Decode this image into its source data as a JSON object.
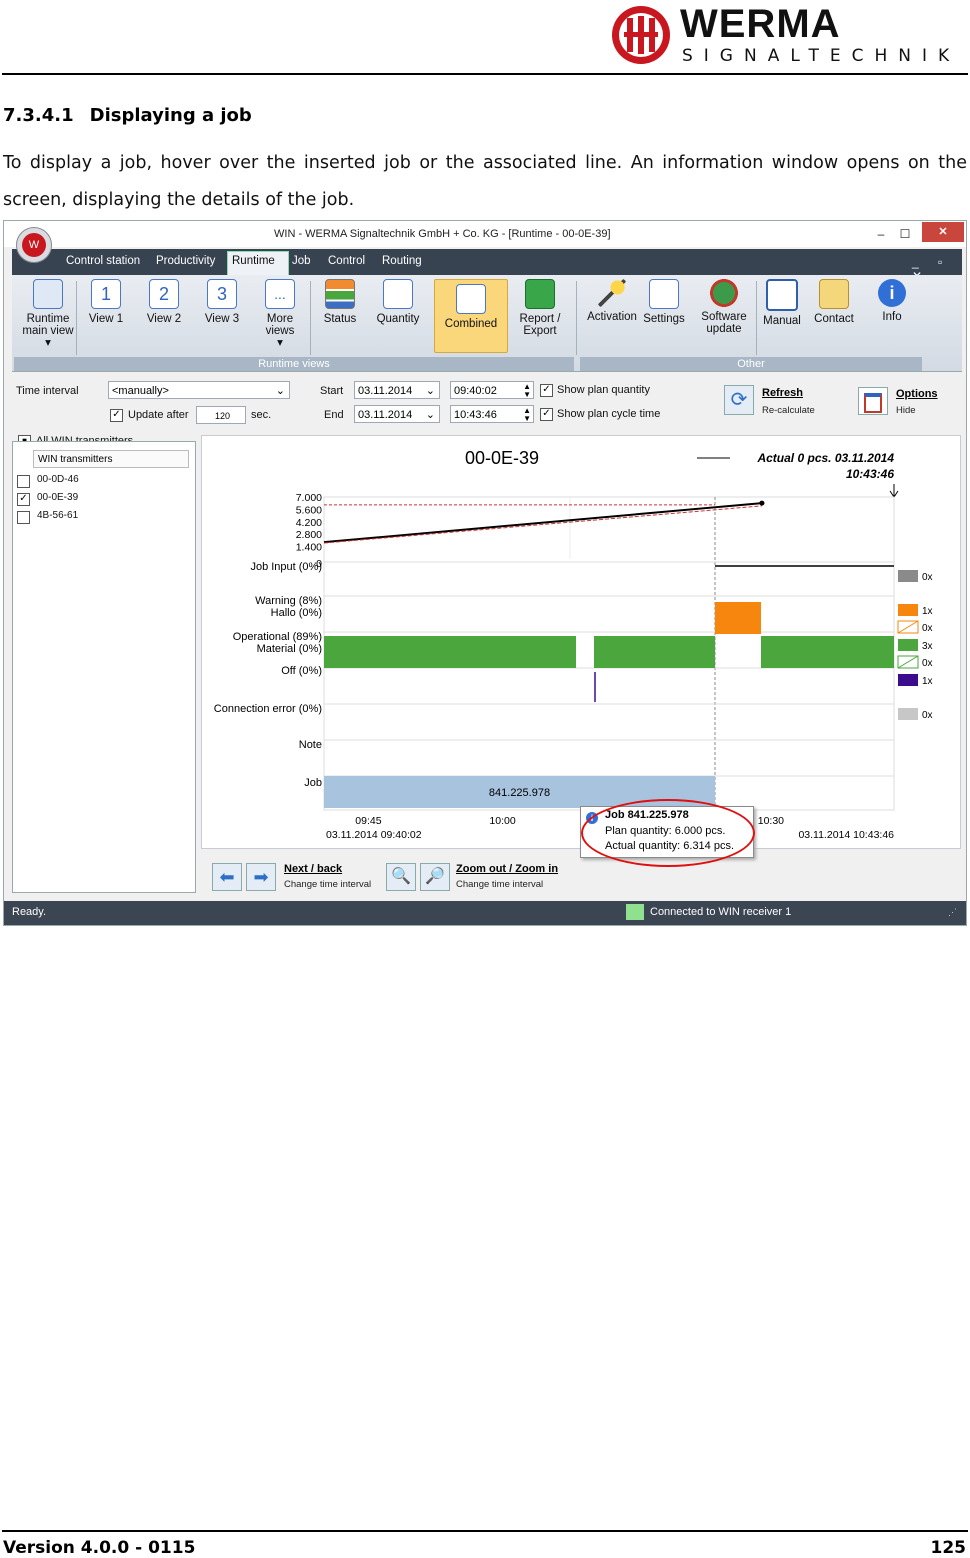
{
  "header": {
    "brand": "WERMA",
    "brand_sub": "SIGNALTECHNIK"
  },
  "section": {
    "number": "7.3.4.1",
    "title": "Displaying a job",
    "body": "To display a job, hover over the inserted job or the associated line. An information window opens on the screen, displaying the details of the job."
  },
  "footer": {
    "version": "Version 4.0.0 - 0115",
    "page": "125"
  },
  "app": {
    "title": "WIN - WERMA Signaltechnik GmbH + Co. KG - [Runtime - 00-0E-39]",
    "window_buttons": {
      "minimize": "–",
      "maximize": "☐",
      "close": "✕"
    },
    "menu_tabs": [
      "Control station",
      "Productivity",
      "Runtime",
      "Job",
      "Control",
      "Routing"
    ],
    "menu_right": "_ ▫ ✕",
    "ribbon": {
      "groups": [
        {
          "label": "Runtime views"
        },
        {
          "label": "Other"
        }
      ],
      "buttons": [
        {
          "line1": "Runtime",
          "line2": "main view",
          "line3": "▾"
        },
        {
          "line1": "View 1",
          "line2": "",
          "line3": ""
        },
        {
          "line1": "View 2",
          "line2": "",
          "line3": ""
        },
        {
          "line1": "View 3",
          "line2": "",
          "line3": ""
        },
        {
          "line1": "More",
          "line2": "views",
          "line3": "▾"
        },
        {
          "line1": "Status",
          "line2": "",
          "line3": ""
        },
        {
          "line1": "Quantity",
          "line2": "",
          "line3": ""
        },
        {
          "line1": "Combined",
          "line2": "",
          "line3": ""
        },
        {
          "line1": "Report /",
          "line2": "Export",
          "line3": ""
        },
        {
          "line1": "Activation",
          "line2": "",
          "line3": ""
        },
        {
          "line1": "Settings",
          "line2": "",
          "line3": ""
        },
        {
          "line1": "Software",
          "line2": "update",
          "line3": ""
        },
        {
          "line1": "Manual",
          "line2": "",
          "line3": ""
        },
        {
          "line1": "Contact",
          "line2": "",
          "line3": ""
        },
        {
          "line1": "Info",
          "line2": "",
          "line3": ""
        }
      ],
      "view_numbers": [
        "1",
        "2",
        "3",
        "..."
      ]
    },
    "controls": {
      "time_interval_label": "Time interval",
      "time_interval_value": "<manually>",
      "update_after_label": "Update after",
      "update_after_value": "120",
      "sec_label": "sec.",
      "start_label": "Start",
      "start_date": "03.11.2014",
      "start_time": "09:40:02",
      "end_label": "End",
      "end_date": "03.11.2014",
      "end_time": "10:43:46",
      "show_plan_quantity": "Show plan quantity",
      "show_plan_cycle_time": "Show plan cycle time",
      "refresh": "Refresh",
      "recalculate": "Re-calculate",
      "options": "Options",
      "hide": "Hide"
    },
    "left_panel": {
      "all_transmitters": "All WIN transmitters",
      "column_header": "WIN transmitters",
      "items": [
        {
          "id": "00-0D-46",
          "checked": false
        },
        {
          "id": "00-0E-39",
          "checked": true
        },
        {
          "id": "4B-56-61",
          "checked": false
        }
      ]
    },
    "nav": {
      "next_back": "Next / back",
      "change_interval_1": "Change time interval",
      "zoom": "Zoom out / Zoom in",
      "change_interval_2": "Change time interval"
    },
    "status": {
      "ready": "Ready.",
      "connected": "Connected to WIN receiver 1",
      "connected_color": "#8fe08f"
    },
    "tooltip": {
      "title": "Job 841.225.978",
      "plan": "Plan quantity: 6.000 pcs.",
      "actual": "Actual quantity: 6.314 pcs."
    }
  },
  "chart_data": {
    "type": "line",
    "title": "00-0E-39",
    "annotation": "Actual 0 pcs.  03.11.2014",
    "annotation_time": "10:43:46",
    "y_ticks": [
      "7.000",
      "5.600",
      "4.200",
      "2.800",
      "1.400",
      "0"
    ],
    "ylim": [
      0,
      7000
    ],
    "x_ticks": [
      "09:45",
      "10:00",
      "10:30"
    ],
    "x_range_labels": [
      "03.11.2014 09:40:02",
      "03.11.2014 10:43:46"
    ],
    "quantity_series": [
      {
        "name": "actual",
        "points": [
          [
            "09:40:02",
            1900
          ],
          [
            "10:29:00",
            6314
          ]
        ]
      },
      {
        "name": "plan",
        "points": [
          [
            "09:40:02",
            1800
          ],
          [
            "10:29:00",
            6000
          ]
        ]
      }
    ],
    "status_rows": [
      {
        "label": "Job Input (0%)",
        "count": "0x",
        "color": "#8a8a8a"
      },
      {
        "label": "Warning (8%)",
        "label2": "Hallo (0%)",
        "count": "1x",
        "count2": "0x",
        "color": "#f7860f"
      },
      {
        "label": "Operational (89%)",
        "label2": "Material (0%)",
        "count": "3x",
        "count2": "0x",
        "color": "#4aa63d"
      },
      {
        "label": "Off (0%)",
        "count": "1x",
        "color": "#3b0d8c"
      },
      {
        "label": "Connection error (0%)",
        "count": "0x",
        "color": "#c7c7c7"
      },
      {
        "label": "Note"
      },
      {
        "label": "Job",
        "job_label": "841.225.978",
        "color": "#a8c3de"
      }
    ]
  }
}
